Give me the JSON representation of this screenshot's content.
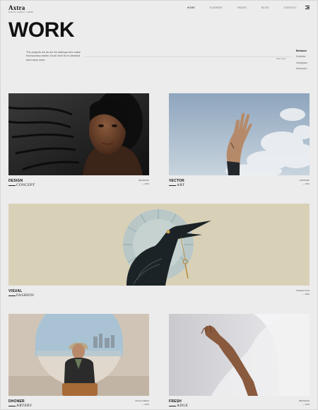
{
  "logo": {
    "name": "Axtra",
    "tagline": "DIGITAL AGENCY THEME"
  },
  "nav": [
    {
      "label": "HOME",
      "active": true
    },
    {
      "label": "ELEMENT",
      "active": false
    },
    {
      "label": "PAGES",
      "active": false
    },
    {
      "label": "BLOG",
      "active": false
    },
    {
      "label": "CONTACT",
      "active": false
    }
  ],
  "hero": {
    "title": "WORK",
    "intro": "The projects we do are for startups who make bureaucracy easier, touch tech for in-demand and many more.",
    "filter_note": "Filter work"
  },
  "social": [
    "Behance",
    "Dribbble",
    "Instagram",
    "Awwward"
  ],
  "projects": [
    {
      "title": "DESIGN",
      "subtitle": "CONCEPT",
      "category": "BRANDING",
      "year": "2018"
    },
    {
      "title": "VECTOR",
      "subtitle": "ART",
      "category": "ARTWORK",
      "year": "2019"
    },
    {
      "title": "VISUAL",
      "subtitle": "FASHION",
      "category": "INTERACTION",
      "year": "2019"
    },
    {
      "title": "DHONER",
      "subtitle": "ARTERY",
      "category": "SOCIAL MEDIA",
      "year": "2019"
    },
    {
      "title": "FRESH",
      "subtitle": "ADGE",
      "category": "BRANDING",
      "year": "2019"
    }
  ],
  "colors": {
    "background": "#ececed",
    "text": "#111111",
    "muted": "#666666"
  }
}
